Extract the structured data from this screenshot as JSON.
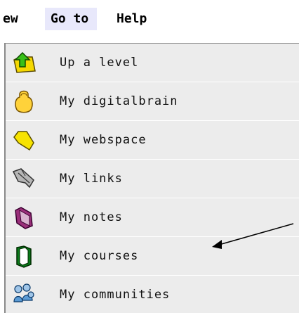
{
  "menubar": {
    "view_label": "ew",
    "goto_label": "Go to",
    "help_label": "Help"
  },
  "menu": {
    "items": [
      {
        "label": "Up a level",
        "icon": "up-level-icon"
      },
      {
        "label": "My digitalbrain",
        "icon": "digitalbrain-icon"
      },
      {
        "label": "My webspace",
        "icon": "webspace-folder-icon"
      },
      {
        "label": "My links",
        "icon": "links-icon"
      },
      {
        "label": "My notes",
        "icon": "notes-icon"
      },
      {
        "label": "My courses",
        "icon": "courses-book-icon"
      },
      {
        "label": "My communities",
        "icon": "communities-people-icon"
      }
    ]
  },
  "colors": {
    "menu_background": "#ececec",
    "menubar_highlight": "#e8e8fb"
  }
}
